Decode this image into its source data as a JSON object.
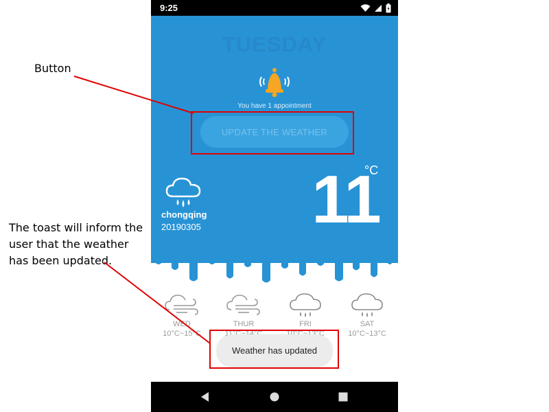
{
  "status_bar": {
    "time": "9:25"
  },
  "hero": {
    "day": "TUESDAY",
    "appointment_text": "You have 1 appointment",
    "update_button_label": "UPDATE THE WEATHER",
    "city": "chongqing",
    "date": "20190305",
    "temperature": "11",
    "unit": "°C",
    "icon": "cloud-rain-icon"
  },
  "forecast": [
    {
      "day": "WED",
      "range": "10°C~15°C",
      "icon": "cloud-wind-icon"
    },
    {
      "day": "THUR",
      "range": "11°C~14°C",
      "icon": "cloud-wind-icon"
    },
    {
      "day": "FRI",
      "range": "10°C~13°C",
      "icon": "cloud-rain-icon"
    },
    {
      "day": "SAT",
      "range": "10°C~13°C",
      "icon": "cloud-rain-icon"
    }
  ],
  "toast": {
    "text": "Weather has updated"
  },
  "annotations": {
    "button_label": "Button",
    "toast_note": "The toast will inform the user that the weather has been updated."
  },
  "colors": {
    "hero_blue": "#2793d5",
    "button_blue": "#3aa4e0",
    "bell_orange": "#f5a623",
    "annotation_red": "#e00000"
  }
}
